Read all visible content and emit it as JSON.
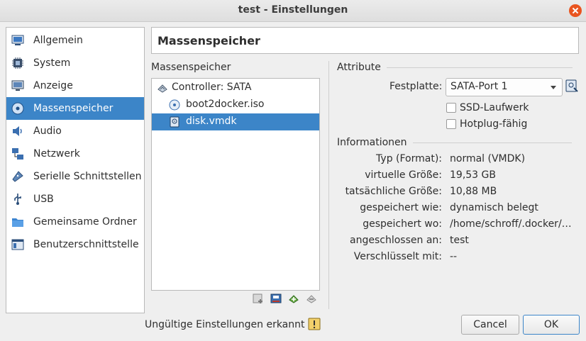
{
  "window": {
    "title": "test - Einstellungen"
  },
  "sidebar": {
    "items": [
      {
        "label": "Allgemein",
        "icon": "general-icon"
      },
      {
        "label": "System",
        "icon": "system-chip-icon"
      },
      {
        "label": "Anzeige",
        "icon": "display-monitor-icon"
      },
      {
        "label": "Massenspeicher",
        "icon": "storage-disk-icon",
        "selected": true
      },
      {
        "label": "Audio",
        "icon": "speaker-icon"
      },
      {
        "label": "Netzwerk",
        "icon": "network-icon"
      },
      {
        "label": "Serielle Schnittstellen",
        "icon": "serial-port-icon"
      },
      {
        "label": "USB",
        "icon": "usb-icon"
      },
      {
        "label": "Gemeinsame Ordner",
        "icon": "shared-folder-icon"
      },
      {
        "label": "Benutzerschnittstelle",
        "icon": "user-interface-icon"
      }
    ]
  },
  "page": {
    "title": "Massenspeicher"
  },
  "storage": {
    "section_label": "Massenspeicher",
    "tree": [
      {
        "label": "Controller: SATA",
        "icon": "controller-icon",
        "level": 0
      },
      {
        "label": "boot2docker.iso",
        "icon": "optical-disc-icon",
        "level": 1
      },
      {
        "label": "disk.vmdk",
        "icon": "hard-disk-icon",
        "level": 1,
        "selected": true
      }
    ],
    "toolbar": [
      "add-controller-icon",
      "remove-attachment-icon",
      "add-attachment-icon",
      "remove-controller-icon"
    ]
  },
  "attributes": {
    "section_label": "Attribute",
    "festplatte_label": "Festplatte:",
    "festplatte_value": "SATA-Port 1",
    "ssd_label": "SSD-Laufwerk",
    "hotplug_label": "Hotplug-fähig"
  },
  "informationen": {
    "section_label": "Informationen",
    "rows": [
      {
        "key": "Typ (Format):",
        "value": "normal (VMDK)"
      },
      {
        "key": "virtuelle Größe:",
        "value": "19,53 GB"
      },
      {
        "key": "tatsächliche Größe:",
        "value": "10,88 MB"
      },
      {
        "key": "gespeichert wie:",
        "value": "dynamisch belegt"
      },
      {
        "key": "gespeichert wo:",
        "value": "/home/schroff/.docker/…"
      },
      {
        "key": "angeschlossen an:",
        "value": "test"
      },
      {
        "key": "Verschlüsselt mit:",
        "value": "--"
      }
    ]
  },
  "footer": {
    "warning": "Ungültige Einstellungen erkannt",
    "cancel": "Cancel",
    "ok": "OK"
  },
  "colors": {
    "selection": "#3c85c8",
    "close": "#e9541f"
  }
}
